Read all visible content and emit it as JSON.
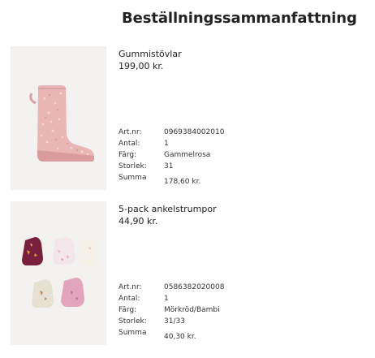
{
  "page": {
    "title": "Beställningssammanfattning"
  },
  "items": [
    {
      "name": "Gummistövlar",
      "price": "199,00 kr.",
      "image": {
        "icon": "pink-rubber-boot-image",
        "color": "#e6b8b6"
      },
      "specs": [
        {
          "label": "Art.nr:",
          "value": "0969384002010"
        },
        {
          "label": "Antal:",
          "value": "1"
        },
        {
          "label": "Färg:",
          "value": "Gammelrosa"
        },
        {
          "label": "Storlek:",
          "value": "31"
        },
        {
          "label": "Summa",
          "value": "178,60 kr."
        }
      ]
    },
    {
      "name": "5-pack ankelstrumpor",
      "price": "44,90 kr.",
      "image": {
        "icon": "ankle-socks-5-pack-image",
        "color": "#7a1f3d"
      },
      "specs": [
        {
          "label": "Art.nr:",
          "value": "0586382020008"
        },
        {
          "label": "Antal:",
          "value": "1"
        },
        {
          "label": "Färg:",
          "value": "Mörkröd/Bambi"
        },
        {
          "label": "Storlek:",
          "value": "31/33"
        },
        {
          "label": "Summa",
          "value": "40,30 kr."
        }
      ]
    }
  ]
}
